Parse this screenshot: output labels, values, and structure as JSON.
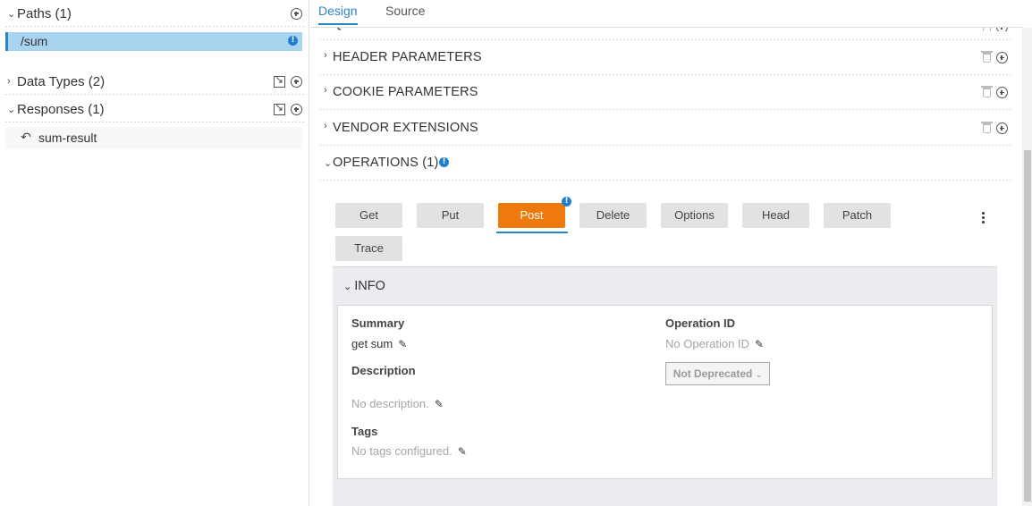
{
  "sidebar": {
    "paths": {
      "label": "Paths (1)",
      "items": [
        {
          "label": "/sum"
        }
      ]
    },
    "data_types": {
      "label": "Data Types (2)"
    },
    "responses": {
      "label": "Responses (1)",
      "items": [
        {
          "label": "sum-result"
        }
      ]
    }
  },
  "tabs": [
    {
      "label": "Design"
    },
    {
      "label": "Source"
    }
  ],
  "sections": [
    {
      "label": "QUERY PARAMETERS"
    },
    {
      "label": "HEADER PARAMETERS"
    },
    {
      "label": "COOKIE PARAMETERS"
    },
    {
      "label": "VENDOR EXTENSIONS"
    },
    {
      "label": "OPERATIONS (1)"
    }
  ],
  "operations": {
    "buttons": [
      "Get",
      "Put",
      "Post",
      "Delete",
      "Options",
      "Head",
      "Patch",
      "Trace"
    ],
    "active": "Post"
  },
  "info": {
    "title": "INFO",
    "summary_label": "Summary",
    "summary_value": "get sum",
    "description_label": "Description",
    "description_value": "No description.",
    "tags_label": "Tags",
    "tags_value": "No tags configured.",
    "operation_id_label": "Operation ID",
    "operation_id_value": "No Operation ID",
    "deprecated_value": "Not Deprecated"
  },
  "colors": {
    "accent": "#2a84c7",
    "active_button": "#ee7a0c",
    "selected_path": "#a9d4f0"
  }
}
